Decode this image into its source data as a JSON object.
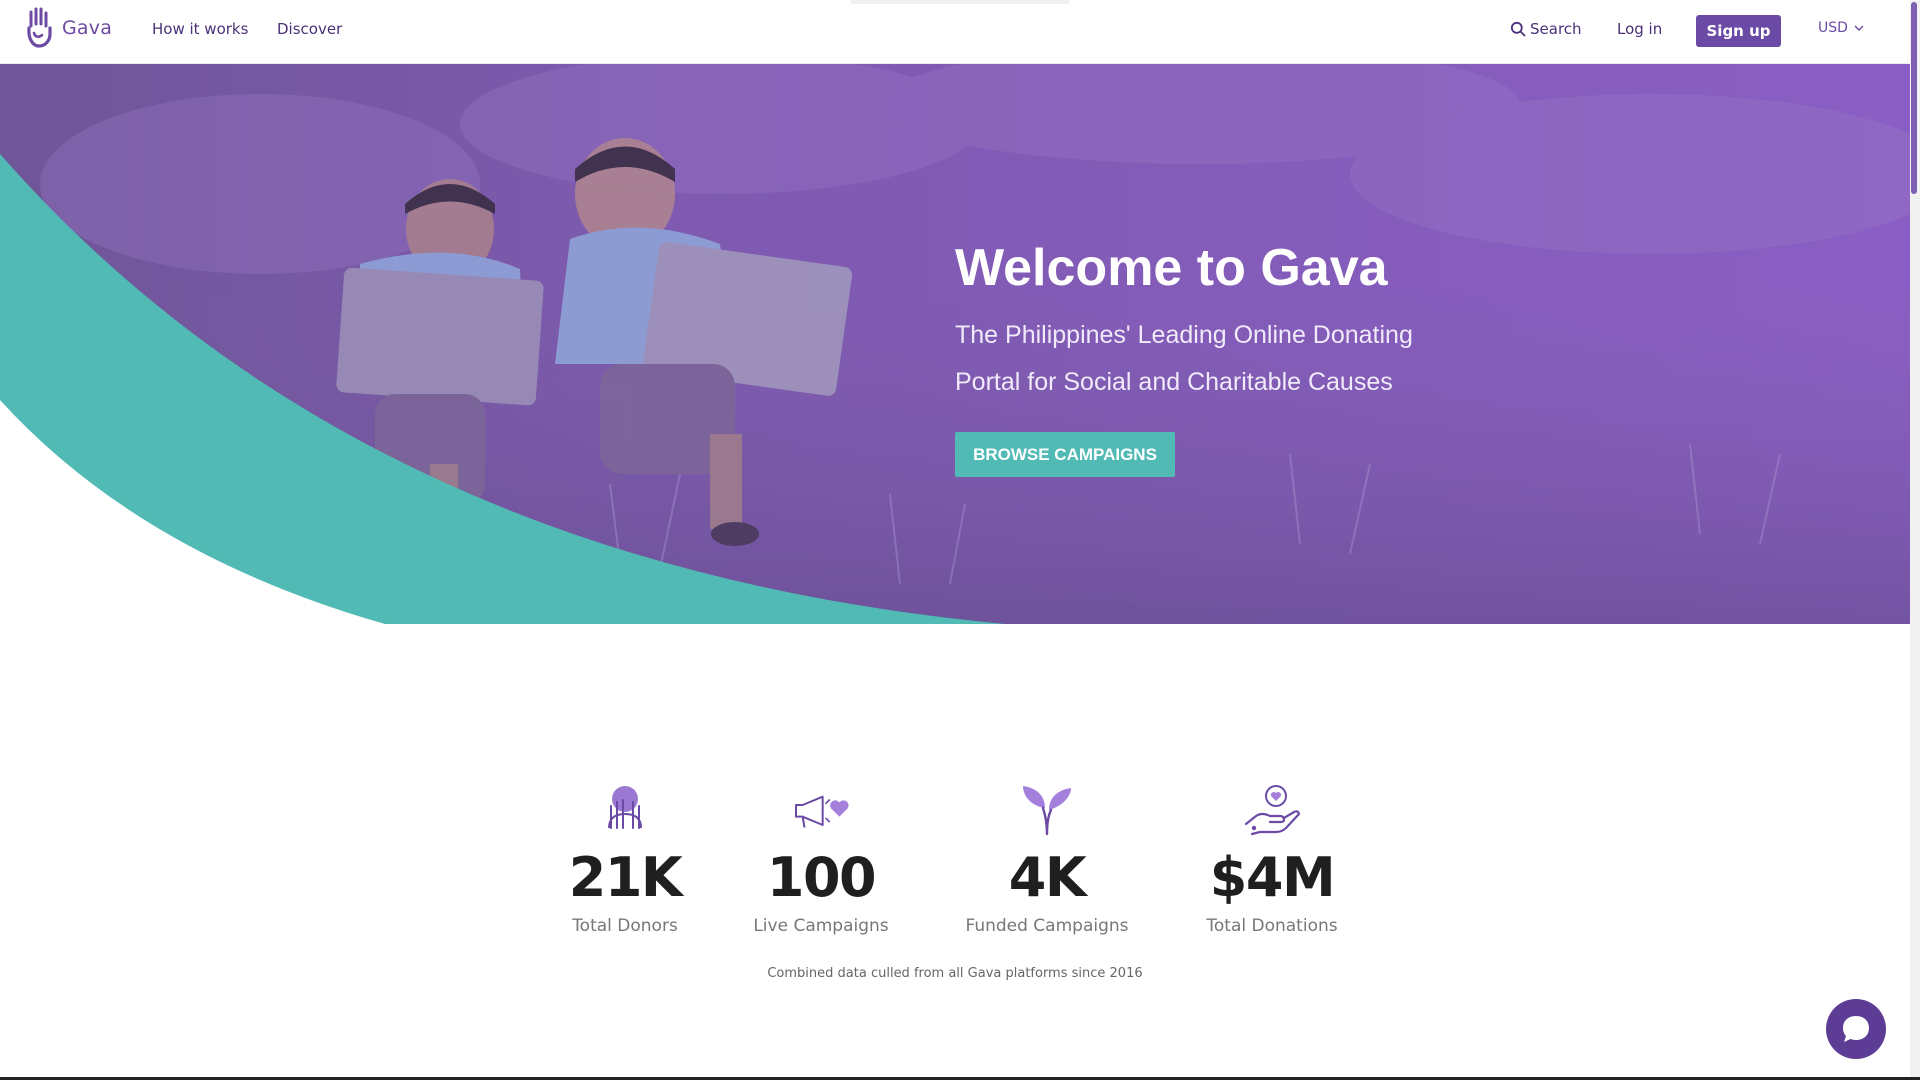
{
  "header": {
    "brand_name": "Gava",
    "nav": [
      {
        "label": "How it works"
      },
      {
        "label": "Discover"
      }
    ],
    "search_label": "Search",
    "login_label": "Log in",
    "signup_label": "Sign up",
    "currency": "USD"
  },
  "hero": {
    "title": "Welcome to Gava",
    "subtitle": "The Philippines' Leading Online Donating Portal for Social and Charitable Causes",
    "cta_label": "BROWSE CAMPAIGNS"
  },
  "stats": [
    {
      "value": "21K",
      "label": "Total Donors",
      "icon": "donor-hands-icon"
    },
    {
      "value": "100",
      "label": "Live Campaigns",
      "icon": "megaphone-heart-icon"
    },
    {
      "value": "4K",
      "label": "Funded Campaigns",
      "icon": "sprout-icon"
    },
    {
      "value": "$4M",
      "label": "Total Donations",
      "icon": "hand-heart-icon"
    }
  ],
  "stats_note": "Combined data culled from all Gava platforms since 2016",
  "colors": {
    "brand_purple": "#6b4aa5",
    "hero_overlay": "#8656c0",
    "teal": "#52bab5",
    "icon_purple": "#7a52b8"
  }
}
